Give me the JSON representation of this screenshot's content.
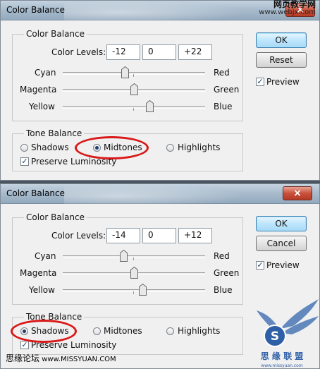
{
  "watermark_top": {
    "line1": "网页教学网",
    "line2": "www.webjx.com"
  },
  "dialogs": [
    {
      "title": "Color Balance",
      "close_icon": "×",
      "color_balance_legend": "Color Balance",
      "color_levels_label": "Color Levels:",
      "levels": [
        "-12",
        "0",
        "+22"
      ],
      "sliders": [
        {
          "left": "Cyan",
          "right": "Red",
          "level": -12
        },
        {
          "left": "Magenta",
          "right": "Green",
          "level": 0
        },
        {
          "left": "Yellow",
          "right": "Blue",
          "level": 22
        }
      ],
      "tone_balance_legend": "Tone Balance",
      "tones": [
        "Shadows",
        "Midtones",
        "Highlights"
      ],
      "selected_tone": "Midtones",
      "preserve_luminosity": "Preserve Luminosity",
      "preserve_checked": true,
      "ok_label": "OK",
      "secondary_label": "Reset",
      "preview_label": "Preview",
      "preview_checked": true
    },
    {
      "title": "Color Balance",
      "close_icon": "×",
      "color_balance_legend": "Color Balance",
      "color_levels_label": "Color Levels:",
      "levels": [
        "-14",
        "0",
        "+12"
      ],
      "sliders": [
        {
          "left": "Cyan",
          "right": "Red",
          "level": -14
        },
        {
          "left": "Magenta",
          "right": "Green",
          "level": 0
        },
        {
          "left": "Yellow",
          "right": "Blue",
          "level": 12
        }
      ],
      "tone_balance_legend": "Tone Balance",
      "tones": [
        "Shadows",
        "Midtones",
        "Highlights"
      ],
      "selected_tone": "Shadows",
      "preserve_luminosity": "Preserve Luminosity",
      "preserve_checked": true,
      "ok_label": "OK",
      "secondary_label": "Cancel",
      "preview_label": "Preview",
      "preview_checked": true
    }
  ],
  "bottom_watermark": {
    "chinese": "思缘论坛",
    "url": "www.MISSYUAN.COM"
  },
  "logo": {
    "text": "思 缘 联 盟",
    "url": "www.missyuan.com"
  },
  "colors": {
    "highlight_oval": "#d91818",
    "default_button": "#bee6fd",
    "close_button": "#c9503a"
  }
}
